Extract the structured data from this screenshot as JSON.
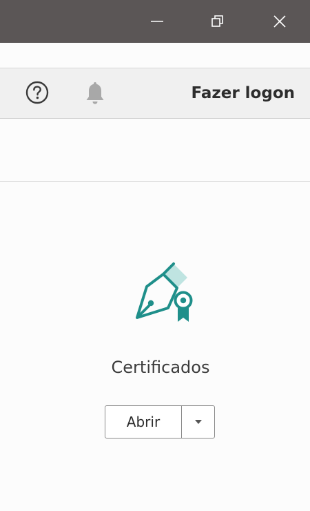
{
  "window": {
    "minimize_icon": "minimize-icon",
    "restore_icon": "restore-icon",
    "close_icon": "close-icon",
    "titlebar_color": "#5b5656"
  },
  "toolbar": {
    "help_icon": "help-circle-icon",
    "bell_icon": "bell-icon",
    "login_label": "Fazer logon"
  },
  "card": {
    "icon": "certificate-pen-icon",
    "title": "Certificados",
    "open_label": "Abrir",
    "dropdown_icon": "caret-down-icon",
    "accent_color": "#1f8f8a"
  }
}
